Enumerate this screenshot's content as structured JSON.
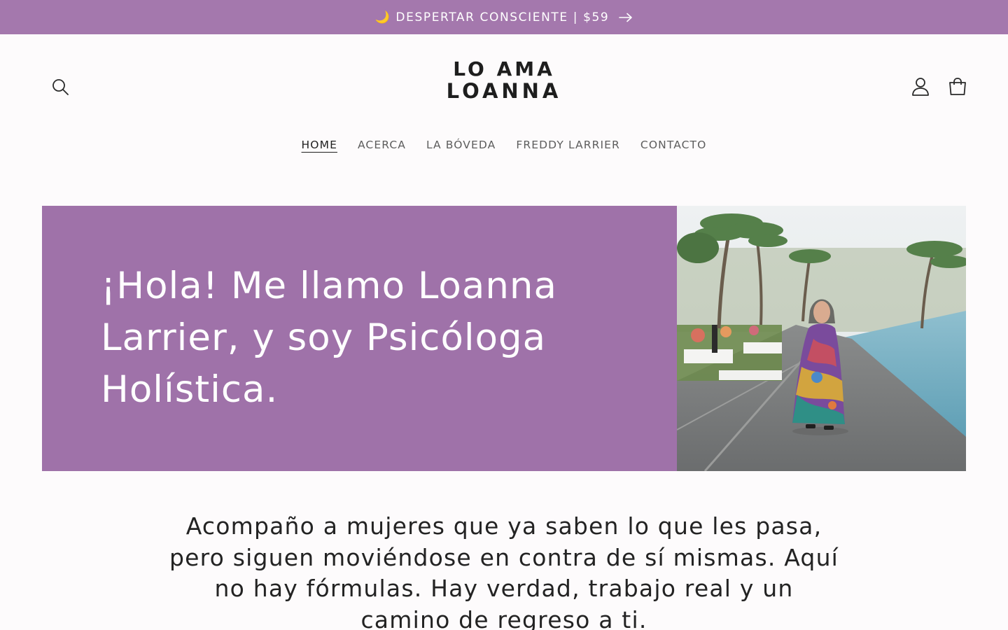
{
  "announcement": {
    "text": "🌙 DESPERTAR CONSCIENTE | $59",
    "arrow_icon": "arrow-right-icon"
  },
  "header": {
    "logo_line1": "LO AMA",
    "logo_line2": "LOANNA",
    "icons": [
      "search-icon",
      "account-icon",
      "cart-icon"
    ]
  },
  "nav": {
    "items": [
      {
        "label": "HOME",
        "active": true
      },
      {
        "label": "ACERCA"
      },
      {
        "label": "LA BÓVEDA"
      },
      {
        "label": "FREDDY LARRIER"
      },
      {
        "label": "CONTACTO"
      }
    ]
  },
  "hero": {
    "heading": "¡Hola! Me llamo Loanna Larrier, y soy Psicóloga Holística.",
    "background_color": "#9f72a9"
  },
  "intro": {
    "text": "Acompaño a mujeres que ya saben lo que les pasa, pero siguen moviéndose en contra de sí mismas. Aquí no hay fórmulas. Hay verdad, trabajo real y un camino de regreso a ti."
  },
  "colors": {
    "announcement_bg": "#a478ad",
    "page_bg": "#fdfbfc",
    "hero_bg": "#9f72a9"
  }
}
